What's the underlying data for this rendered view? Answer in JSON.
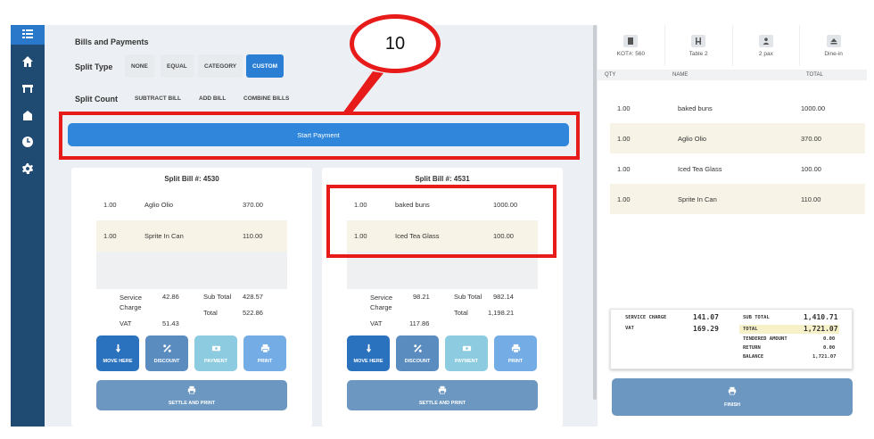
{
  "sidebar": {
    "icons": [
      "grid-icon",
      "home-icon",
      "table-icon",
      "receipt-icon",
      "clock-icon",
      "gear-icon"
    ]
  },
  "main": {
    "section_title": "Bills and Payments",
    "split_type": {
      "label": "Split Type",
      "options": [
        "NONE",
        "EQUAL",
        "CATEGORY",
        "CUSTOM"
      ],
      "selected": "CUSTOM"
    },
    "split_count": {
      "label": "Split Count",
      "options": [
        "SUBTRACT BILL",
        "ADD BILL",
        "COMBINE BILLS"
      ]
    },
    "start_payment_label": "Start Payment"
  },
  "bills": [
    {
      "title": "Split Bill #: 4530",
      "items": [
        {
          "qty": "1.00",
          "name": "Aglio Olio",
          "price": "370.00"
        },
        {
          "qty": "1.00",
          "name": "Sprite In Can",
          "price": "110.00"
        }
      ],
      "service_charge_label": "Service Charge",
      "service_charge": "42.86",
      "vat_label": "VAT",
      "vat": "51.43",
      "subtotal_label": "Sub Total",
      "subtotal": "428.57",
      "total_label": "Total",
      "total": "522.86"
    },
    {
      "title": "Split Bill #: 4531",
      "items": [
        {
          "qty": "1.00",
          "name": "baked buns",
          "price": "1000.00"
        },
        {
          "qty": "1.00",
          "name": "Iced Tea Glass",
          "price": "100.00"
        }
      ],
      "service_charge_label": "Service Charge",
      "service_charge": "98.21",
      "vat_label": "VAT",
      "vat": "117.86",
      "subtotal_label": "Sub Total",
      "subtotal": "982.14",
      "total_label": "Total",
      "total": "1,198.21"
    }
  ],
  "bill_actions": {
    "move_here": "MOVE HERE",
    "discount": "DISCOUNT",
    "payment": "PAYMENT",
    "print": "PRINT",
    "settle_and_print": "SETTLE AND PRINT"
  },
  "order": {
    "kot": "KOT#: 560",
    "table": "Table 2",
    "pax": "2 pax",
    "mode": "Dine-in",
    "columns": {
      "qty": "QTY",
      "name": "NAME",
      "total": "TOTAL"
    },
    "items": [
      {
        "qty": "1.00",
        "name": "baked buns",
        "total": "1000.00"
      },
      {
        "qty": "1.00",
        "name": "Aglio Olio",
        "total": "370.00"
      },
      {
        "qty": "1.00",
        "name": "Iced Tea Glass",
        "total": "100.00"
      },
      {
        "qty": "1.00",
        "name": "Sprite In Can",
        "total": "110.00"
      }
    ],
    "totals": {
      "service_charge_label": "SERVICE CHARGE",
      "service_charge": "141.07",
      "vat_label": "VAT",
      "vat": "169.29",
      "subtotal_label": "SUB TOTAL",
      "subtotal": "1,410.71",
      "total_label": "TOTAL",
      "total": "1,721.07",
      "tendered_label": "TENDERED AMOUNT",
      "tendered": "0.00",
      "return_label": "RETURN",
      "return": "0.00",
      "balance_label": "BALANCE",
      "balance": "1,721.07"
    },
    "finish_label": "FINISH"
  },
  "annotation": {
    "step_number": "10",
    "color": "#e81b1b"
  }
}
